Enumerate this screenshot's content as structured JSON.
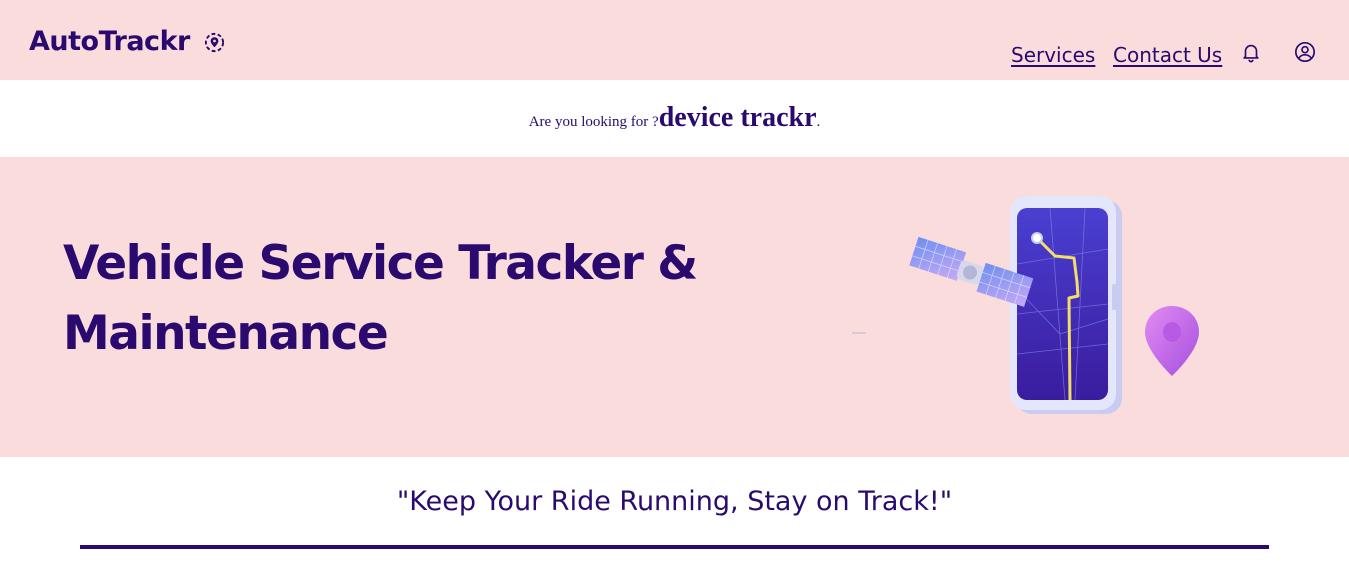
{
  "header": {
    "brand": "AutoTrackr",
    "brand_icon": "location-pin-icon",
    "nav": [
      {
        "label": "Services"
      },
      {
        "label": "Contact Us"
      }
    ],
    "notification_icon": "bell-icon",
    "profile_icon": "user-circle-icon"
  },
  "search": {
    "prefix": "Are you looking for ?",
    "keyword": "device trackr",
    "suffix": "."
  },
  "hero": {
    "title": "Vehicle Service Tracker & Maintenance",
    "illustration": "satellite-phone-map-illustration"
  },
  "tagline": "\"Keep Your Ride Running, Stay on Track!\"",
  "colors": {
    "primary": "#2a0a6e",
    "background_pink": "#f9dcdb",
    "white": "#ffffff"
  }
}
